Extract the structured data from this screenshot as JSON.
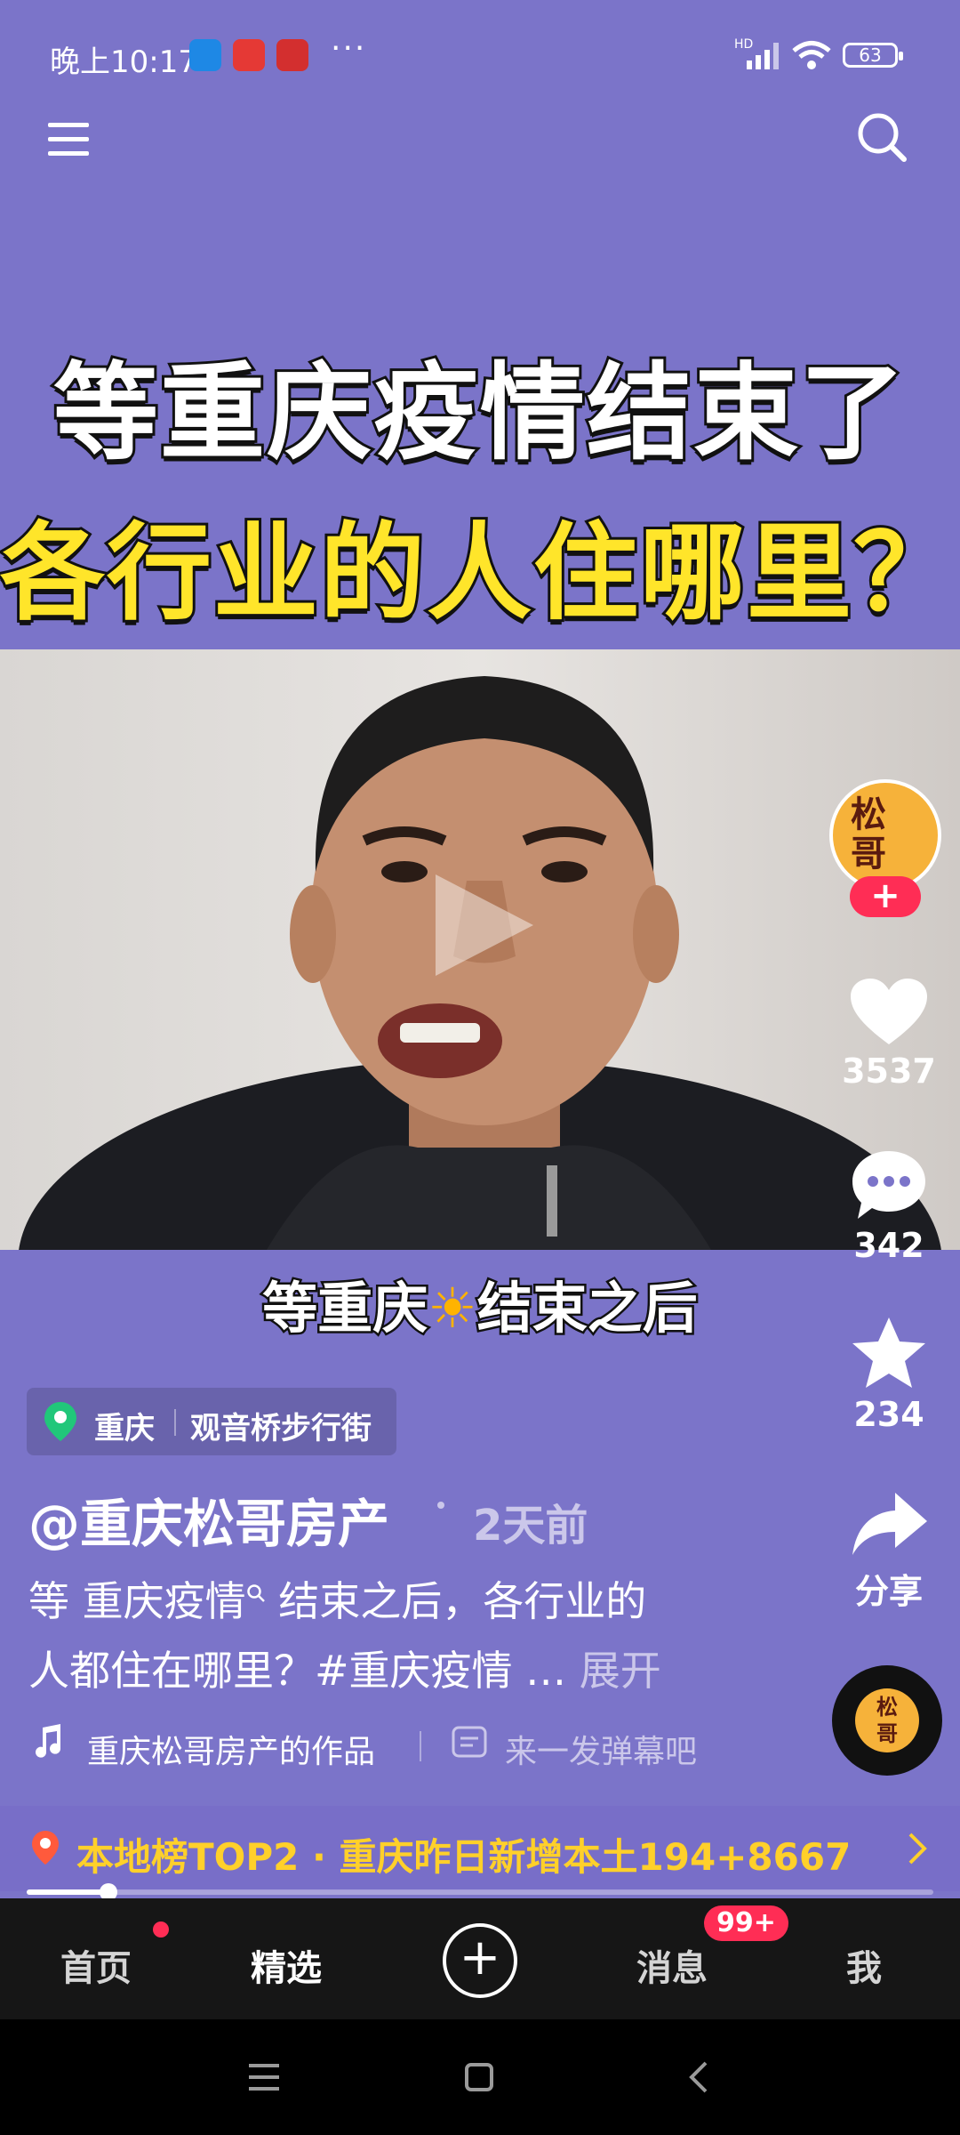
{
  "status_bar": {
    "time": "晚上10:17",
    "dots": "···",
    "network": "HD",
    "battery": "63"
  },
  "headline": {
    "line1": "等重庆疫情结束了",
    "line2": "各行业的人住哪里？"
  },
  "video": {
    "subtitle_before": "等重庆",
    "subtitle_after": "结束之后"
  },
  "creator": {
    "avatar_text_1": "松",
    "avatar_text_2": "哥",
    "follow_label": "+"
  },
  "actions": {
    "likes": "3537",
    "comments": "342",
    "favorites": "234",
    "share_label": "分享"
  },
  "location": {
    "city": "重庆",
    "place": "观音桥步行街"
  },
  "post": {
    "author": "@重庆松哥房产",
    "time_ago": "2天前",
    "desc_line1_a": "等 重庆疫情",
    "desc_line1_b": " 结束之后，各行业的",
    "desc_line2": "人都住在哪里？#重庆疫情 …",
    "expand_label": "展开",
    "music": "重庆松哥房产的作品",
    "danmu_placeholder": "来一发弹幕吧"
  },
  "disc_text": "松\n哥",
  "hot_banner": {
    "text": "本地榜TOP2 · 重庆昨日新增本土194+8667"
  },
  "progress": {
    "fraction": 0.09
  },
  "tabs": {
    "home": "首页",
    "featured": "精选",
    "plus": "+",
    "messages": "消息",
    "messages_badge": "99+",
    "me": "我"
  },
  "colors": {
    "background": "#7b74c9",
    "accent_red": "#ff2d55",
    "yellow": "#ffd02a"
  }
}
